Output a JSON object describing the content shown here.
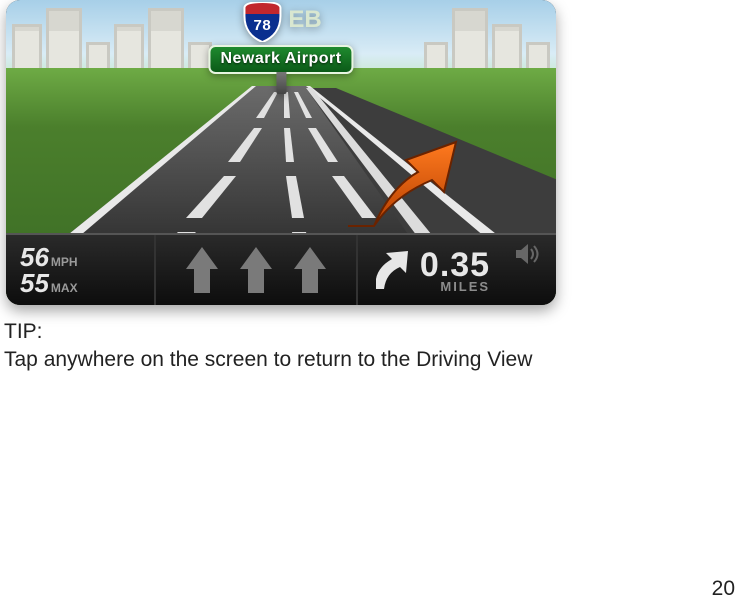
{
  "gps": {
    "sign": {
      "route_number": "78",
      "direction_suffix": "EB",
      "destination": "Newark Airport"
    },
    "status": {
      "speed_value": "56",
      "speed_unit": "MPH",
      "limit_value": "55",
      "limit_unit": "MAX",
      "distance_value": "0.35",
      "distance_unit": "MILES"
    },
    "icons": {
      "lane_arrow": "up-arrow-icon",
      "turn": "bear-right-icon",
      "speaker": "speaker-icon"
    }
  },
  "tip": {
    "heading": "TIP:",
    "body": "Tap anywhere on the screen to return to the Driving View"
  },
  "page_number": "20"
}
